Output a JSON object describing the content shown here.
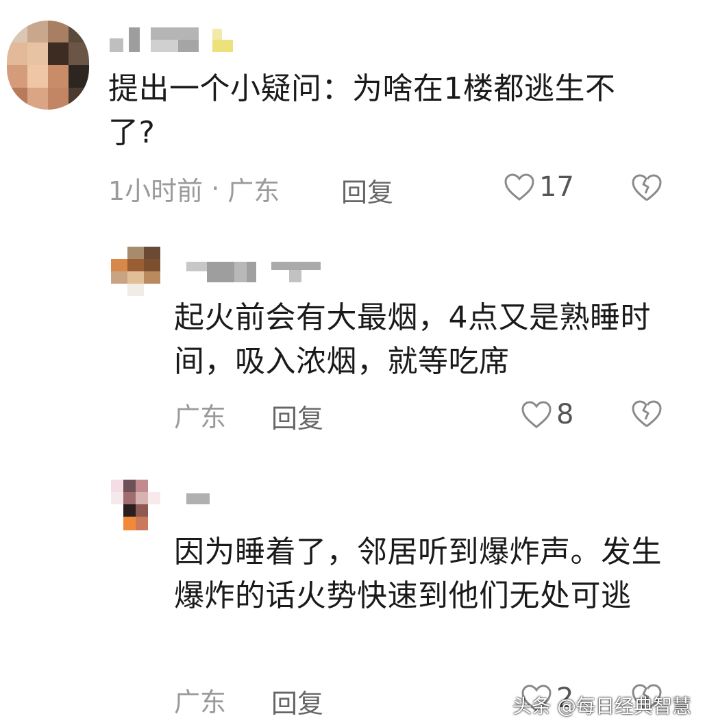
{
  "colors": {
    "text": "#1a1a1a",
    "meta": "#9a9a9a",
    "reply": "#666666",
    "icon": "#8a8a8a"
  },
  "comments": [
    {
      "text": "提出一个小疑问：为啥在1楼都逃生不了?",
      "time": "1小时前",
      "dot": "·",
      "location": "广东",
      "reply_label": "回复",
      "likes": "17",
      "like_icon": "heart-outline-icon",
      "dislike_icon": "broken-heart-icon"
    },
    {
      "text": "起火前会有大最烟，4点又是熟睡时间，吸入浓烟，就等吃席",
      "location": "广东",
      "reply_label": "回复",
      "likes": "8",
      "like_icon": "heart-outline-icon",
      "dislike_icon": "broken-heart-icon"
    },
    {
      "text": "因为睡着了，邻居听到爆炸声。发生爆炸的话火势快速到他们无处可逃",
      "location": "广东",
      "reply_label": "回复",
      "likes": "2",
      "like_icon": "heart-outline-icon",
      "dislike_icon": "broken-heart-icon"
    }
  ],
  "watermark": "头条 @每日经典智慧"
}
